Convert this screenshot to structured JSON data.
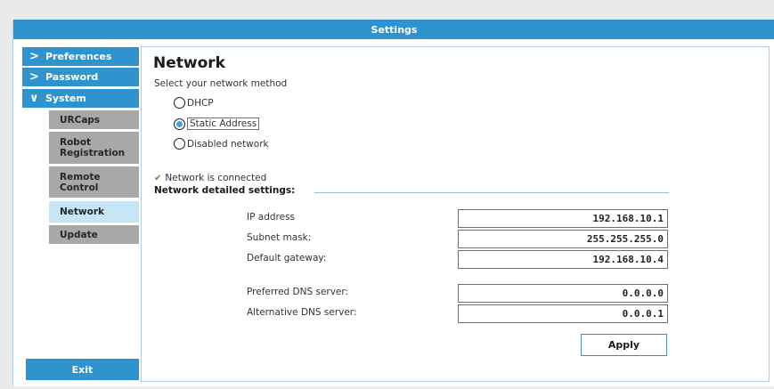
{
  "window": {
    "title": "Settings"
  },
  "sidebar": {
    "items": [
      {
        "label": "Preferences",
        "icon": "chevron-right-icon",
        "glyph": ">"
      },
      {
        "label": "Password",
        "icon": "chevron-right-icon",
        "glyph": ">"
      },
      {
        "label": "System",
        "icon": "chevron-down-icon",
        "glyph": "∨"
      }
    ],
    "system_children": [
      {
        "label": "URCaps"
      },
      {
        "label": "Robot\nRegistration"
      },
      {
        "label": "Remote\nControl"
      },
      {
        "label": "Network",
        "selected": true
      },
      {
        "label": "Update"
      }
    ],
    "exit_label": "Exit"
  },
  "main": {
    "title": "Network",
    "subtitle": "Select your network method",
    "methods": [
      {
        "label": "DHCP",
        "checked": false
      },
      {
        "label": "Static Address",
        "checked": true
      },
      {
        "label": "Disabled network",
        "checked": false
      }
    ],
    "status_text": "Network is connected",
    "status_icon": "checkmark-icon",
    "section_title": "Network detailed settings:",
    "fields": {
      "ip_label": "IP address",
      "ip_value": "192.168.10.1",
      "subnet_label": "Subnet mask:",
      "subnet_value": "255.255.255.0",
      "gateway_label": "Default gateway:",
      "gateway_value": "192.168.10.4",
      "pref_dns_label": "Preferred DNS server:",
      "pref_dns_value": "0.0.0.0",
      "alt_dns_label": "Alternative DNS server:",
      "alt_dns_value": "0.0.0.1"
    },
    "apply_label": "Apply"
  },
  "colors": {
    "accent": "#2f93cf",
    "submenu": "#a8a8a8",
    "submenu_selected": "#c6e6f7",
    "status_check": "#4c9a3a"
  }
}
